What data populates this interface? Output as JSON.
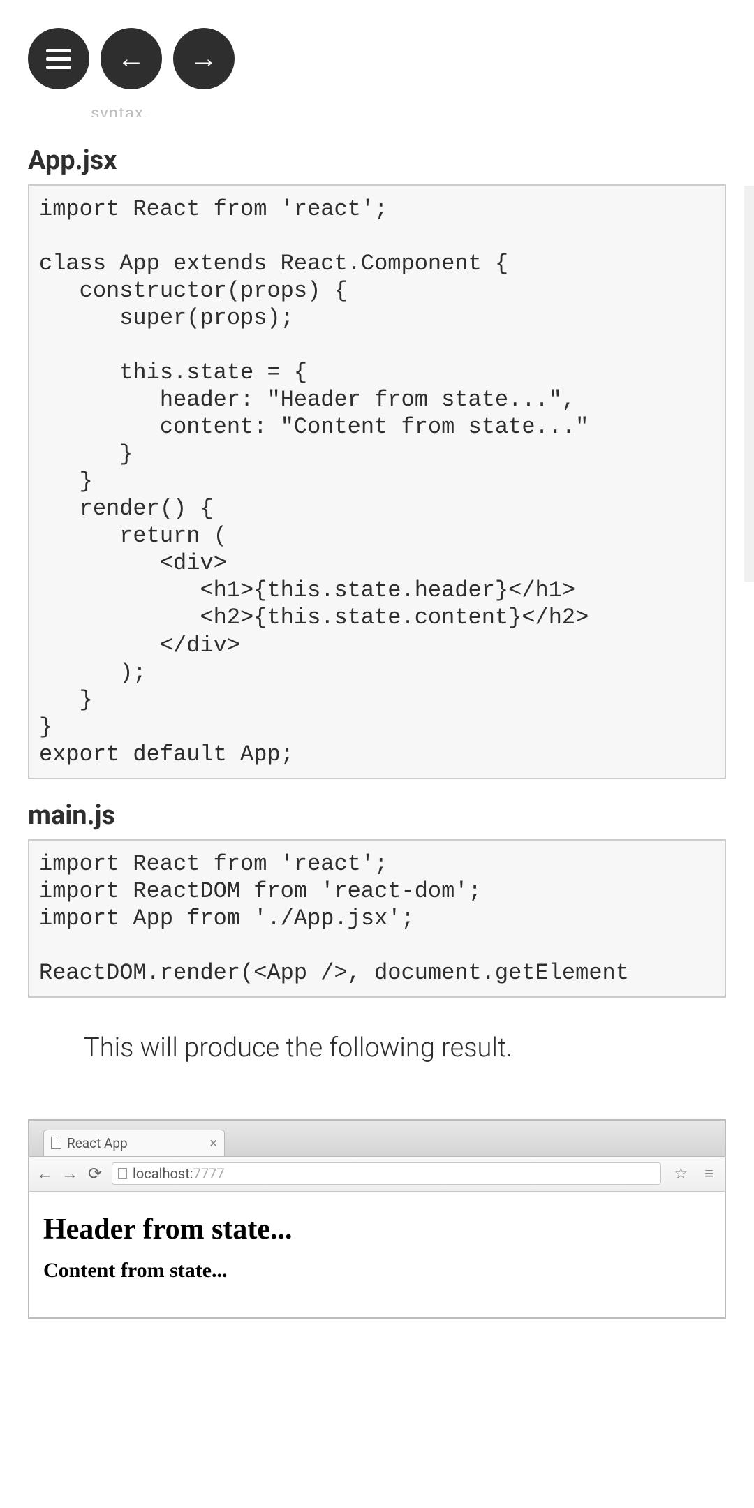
{
  "nav": {
    "menu_label": "menu",
    "prev_label": "←",
    "next_label": "→"
  },
  "partial_line": "syntax.",
  "files": [
    {
      "name": "App.jsx",
      "code": "import React from 'react';\n\nclass App extends React.Component {\n   constructor(props) {\n      super(props);\n\t\t\n      this.state = {\n         header: \"Header from state...\",\n         content: \"Content from state...\"\n      }\n   }\n   render() {\n      return (\n         <div>\n            <h1>{this.state.header}</h1>\n            <h2>{this.state.content}</h2>\n         </div>\n      );\n   }\n}\nexport default App;"
    },
    {
      "name": "main.js",
      "code": "import React from 'react';\nimport ReactDOM from 'react-dom';\nimport App from './App.jsx';\n\nReactDOM.render(<App />, document.getElement"
    }
  ],
  "result_text": "This will produce the following result.",
  "browser": {
    "tab_title": "React App",
    "url_host": "localhost:",
    "url_port": "7777",
    "rendered": {
      "h1": "Header from state...",
      "h2": "Content from state..."
    }
  }
}
